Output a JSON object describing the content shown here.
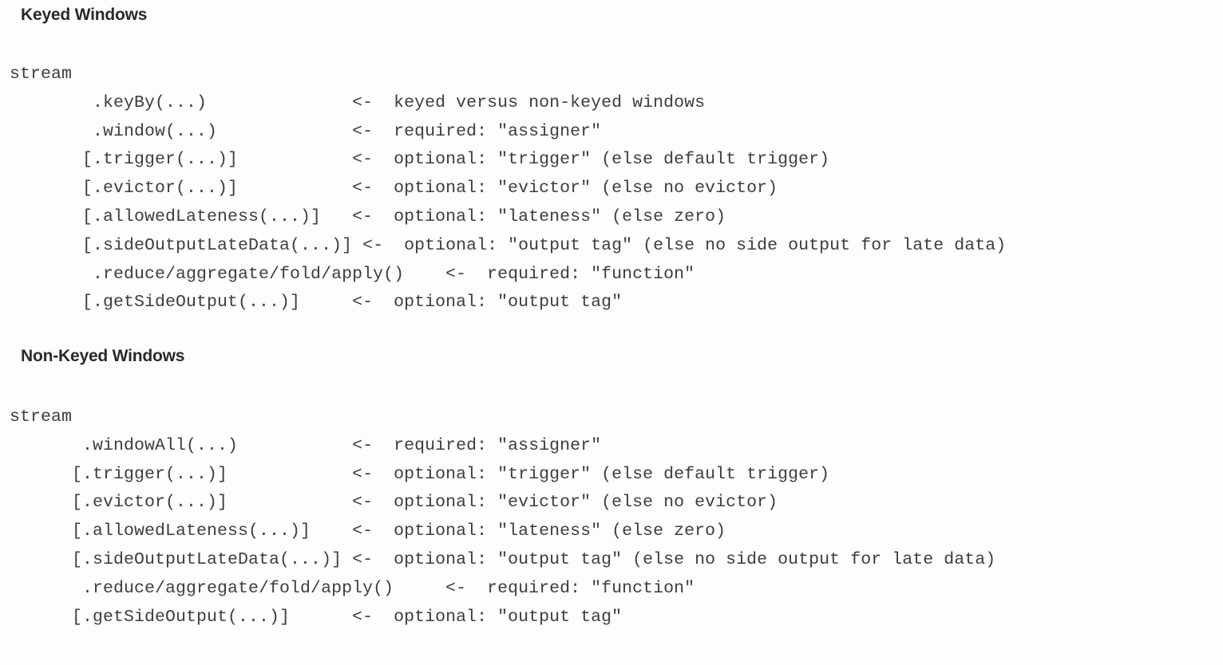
{
  "document": {
    "background_color": "#fdfdfd",
    "text_color": "#403d3a",
    "heading_color": "#2a2a2a"
  },
  "sections": [
    {
      "id": "keyed",
      "heading": "Keyed Windows",
      "root": "stream",
      "lines": [
        {
          "code": "        .keyBy(...)              ",
          "arrow": "<- ",
          "comment": " keyed versus non-keyed windows"
        },
        {
          "code": "        .window(...)             ",
          "arrow": "<- ",
          "comment": " required: \"assigner\""
        },
        {
          "code": "       [.trigger(...)]           ",
          "arrow": "<- ",
          "comment": " optional: \"trigger\" (else default trigger)"
        },
        {
          "code": "       [.evictor(...)]           ",
          "arrow": "<- ",
          "comment": " optional: \"evictor\" (else no evictor)"
        },
        {
          "code": "       [.allowedLateness(...)]   ",
          "arrow": "<- ",
          "comment": " optional: \"lateness\" (else zero)"
        },
        {
          "code": "       [.sideOutputLateData(...)] ",
          "arrow": "<- ",
          "comment": " optional: \"output tag\" (else no side output for late data)"
        },
        {
          "code": "        .reduce/aggregate/fold/apply()    ",
          "arrow": "<- ",
          "comment": " required: \"function\""
        },
        {
          "code": "       [.getSideOutput(...)]     ",
          "arrow": "<- ",
          "comment": " optional: \"output tag\""
        }
      ]
    },
    {
      "id": "nonkeyed",
      "heading": "Non-Keyed Windows",
      "root": "stream",
      "lines": [
        {
          "code": "       .windowAll(...)           ",
          "arrow": "<- ",
          "comment": " required: \"assigner\""
        },
        {
          "code": "      [.trigger(...)]            ",
          "arrow": "<- ",
          "comment": " optional: \"trigger\" (else default trigger)"
        },
        {
          "code": "      [.evictor(...)]            ",
          "arrow": "<- ",
          "comment": " optional: \"evictor\" (else no evictor)"
        },
        {
          "code": "      [.allowedLateness(...)]    ",
          "arrow": "<- ",
          "comment": " optional: \"lateness\" (else zero)"
        },
        {
          "code": "      [.sideOutputLateData(...)] ",
          "arrow": "<- ",
          "comment": " optional: \"output tag\" (else no side output for late data)"
        },
        {
          "code": "       .reduce/aggregate/fold/apply()     ",
          "arrow": "<- ",
          "comment": " required: \"function\""
        },
        {
          "code": "      [.getSideOutput(...)]      ",
          "arrow": "<- ",
          "comment": " optional: \"output tag\""
        }
      ]
    }
  ]
}
